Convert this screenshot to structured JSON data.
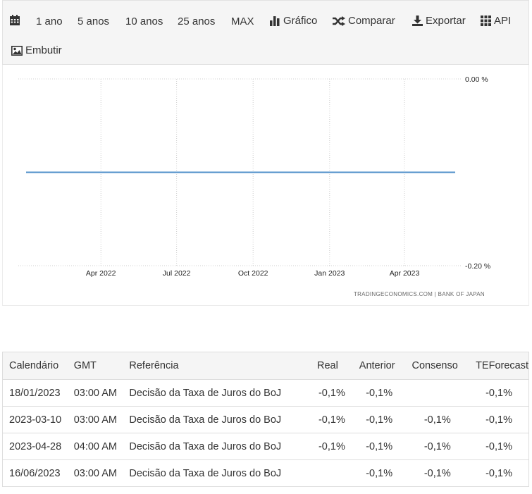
{
  "toolbar": {
    "items": [
      {
        "id": "calendar",
        "icon": "calendar-icon",
        "label": ""
      },
      {
        "id": "1y",
        "icon": "",
        "label": "1 ano"
      },
      {
        "id": "5y",
        "icon": "",
        "label": "5 anos"
      },
      {
        "id": "10y",
        "icon": "",
        "label": "10 anos"
      },
      {
        "id": "25y",
        "icon": "",
        "label": "25 anos"
      },
      {
        "id": "max",
        "icon": "",
        "label": "MAX"
      },
      {
        "id": "chart",
        "icon": "bar-chart-icon",
        "label": "Gráfico"
      },
      {
        "id": "compare",
        "icon": "shuffle-icon",
        "label": "Comparar"
      },
      {
        "id": "export",
        "icon": "download-icon",
        "label": "Exportar"
      },
      {
        "id": "api",
        "icon": "grid-icon",
        "label": "API"
      },
      {
        "id": "embed",
        "icon": "image-icon",
        "label": "Embutir"
      }
    ]
  },
  "chart_data": {
    "type": "line",
    "x": [
      "2022-01",
      "2023-06"
    ],
    "series": [
      {
        "values": [
          -0.1,
          -0.1
        ],
        "color": "#4f8fc9"
      }
    ],
    "ylim": [
      -0.2,
      0.0
    ],
    "y_ticks": [
      "0.00 %",
      "-0.20 %"
    ],
    "x_ticks": [
      "Apr 2022",
      "Jul 2022",
      "Oct 2022",
      "Jan 2023",
      "Apr 2023"
    ],
    "grid": true,
    "source": "TRADINGECONOMICS.COM  |  BANK OF JAPAN"
  },
  "table": {
    "headers": {
      "date": "Calendário",
      "gmt": "GMT",
      "ref": "Referência",
      "real": "Real",
      "ant": "Anterior",
      "cons": "Consenso",
      "tef": "TEForecast"
    },
    "rows": [
      {
        "date": "18/01/2023",
        "gmt": "03:00 AM",
        "ref": "Decisão da Taxa de Juros do BoJ",
        "real": "-0,1%",
        "ant": "-0,1%",
        "cons": "",
        "tef": "-0,1%"
      },
      {
        "date": "2023-03-10",
        "gmt": "03:00 AM",
        "ref": "Decisão da Taxa de Juros do BoJ",
        "real": "-0,1%",
        "ant": "-0,1%",
        "cons": "-0,1%",
        "tef": "-0,1%"
      },
      {
        "date": "2023-04-28",
        "gmt": "04:00 AM",
        "ref": "Decisão da Taxa de Juros do BoJ",
        "real": "-0,1%",
        "ant": "-0,1%",
        "cons": "-0,1%",
        "tef": "-0,1%"
      },
      {
        "date": "16/06/2023",
        "gmt": "03:00 AM",
        "ref": "Decisão da Taxa de Juros do BoJ",
        "real": "",
        "ant": "-0,1%",
        "cons": "-0,1%",
        "tef": "-0,1%"
      }
    ]
  }
}
